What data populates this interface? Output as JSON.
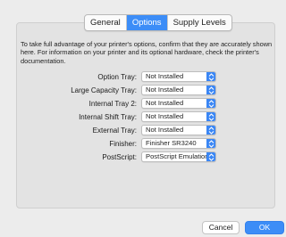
{
  "tabs": [
    {
      "label": "General",
      "active": false
    },
    {
      "label": "Options",
      "active": true
    },
    {
      "label": "Supply Levels",
      "active": false
    }
  ],
  "description": "To take full advantage of your printer's options, confirm that they are accurately shown here. For information on your printer and its optional hardware, check the printer's documentation.",
  "options": [
    {
      "label": "Option Tray:",
      "value": "Not Installed"
    },
    {
      "label": "Large Capacity Tray:",
      "value": "Not Installed"
    },
    {
      "label": "Internal Tray 2:",
      "value": "Not Installed"
    },
    {
      "label": "Internal Shift Tray:",
      "value": "Not Installed"
    },
    {
      "label": "External Tray:",
      "value": "Not Installed"
    },
    {
      "label": "Finisher:",
      "value": "Finisher SR3240"
    },
    {
      "label": "PostScript:",
      "value": "PostScript Emulation"
    }
  ],
  "buttons": {
    "cancel": "Cancel",
    "ok": "OK"
  },
  "colors": {
    "accent": "#3c8df7",
    "window_bg": "#ececec",
    "panel_bg": "#e3e3e3"
  },
  "icons": {
    "popup_arrow": "chevron-up-down-icon"
  }
}
